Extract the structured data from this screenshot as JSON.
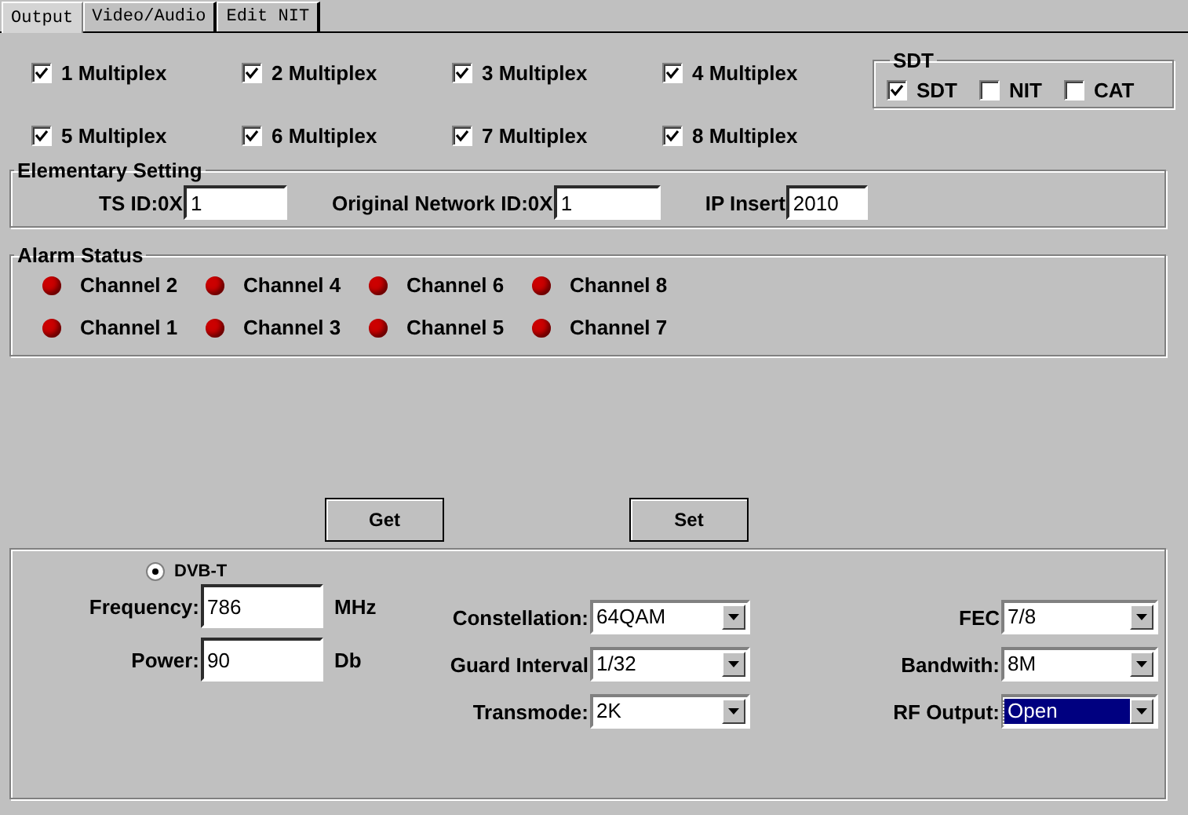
{
  "tabs": [
    {
      "label": "Output",
      "selected": true
    },
    {
      "label": "Video/Audio",
      "selected": false
    },
    {
      "label": "Edit NIT",
      "selected": false
    }
  ],
  "multiplex": [
    {
      "label": "1 Multiplex",
      "checked": true
    },
    {
      "label": "2 Multiplex",
      "checked": true
    },
    {
      "label": "3 Multiplex",
      "checked": true
    },
    {
      "label": "4 Multiplex",
      "checked": true
    },
    {
      "label": "5 Multiplex",
      "checked": true
    },
    {
      "label": "6 Multiplex",
      "checked": true
    },
    {
      "label": "7 Multiplex",
      "checked": true
    },
    {
      "label": "8 Multiplex",
      "checked": true
    }
  ],
  "sdt": {
    "title": "SDT",
    "items": [
      {
        "label": "SDT",
        "checked": true
      },
      {
        "label": "NIT",
        "checked": false
      },
      {
        "label": "CAT",
        "checked": false
      }
    ]
  },
  "elementary": {
    "title": "Elementary Setting",
    "fields": [
      {
        "label": "TS ID:0X",
        "value": "1"
      },
      {
        "label": "Original Network ID:0X",
        "value": "1"
      },
      {
        "label": "IP Insert",
        "value": "2010"
      }
    ]
  },
  "alarm": {
    "title": "Alarm Status",
    "channels": [
      {
        "label": "Channel 2",
        "color": "#cc0000"
      },
      {
        "label": "Channel 4",
        "color": "#cc0000"
      },
      {
        "label": "Channel 6",
        "color": "#cc0000"
      },
      {
        "label": "Channel 8",
        "color": "#cc0000"
      },
      {
        "label": "Channel 1",
        "color": "#cc0000"
      },
      {
        "label": "Channel 3",
        "color": "#cc0000"
      },
      {
        "label": "Channel 5",
        "color": "#cc0000"
      },
      {
        "label": "Channel 7",
        "color": "#cc0000"
      }
    ]
  },
  "buttons": [
    "Get",
    "Set"
  ],
  "dvbt": {
    "label": "DVB-T",
    "selected": true,
    "inputs": [
      {
        "label": "Frequency:",
        "value": "786",
        "unit": "MHz"
      },
      {
        "label": "Power:",
        "value": "90",
        "unit": "Db"
      }
    ],
    "selects_middle": [
      {
        "label": "Constellation:",
        "value": "64QAM",
        "focused": false
      },
      {
        "label": "Guard Interval",
        "value": "1/32",
        "focused": false
      },
      {
        "label": "Transmode:",
        "value": "2K",
        "focused": false
      }
    ],
    "selects_right": [
      {
        "label": "FEC",
        "value": "7/8",
        "focused": false
      },
      {
        "label": "Bandwith:",
        "value": "8M",
        "focused": false
      },
      {
        "label": "RF Output:",
        "value": "Open",
        "focused": true
      }
    ]
  }
}
